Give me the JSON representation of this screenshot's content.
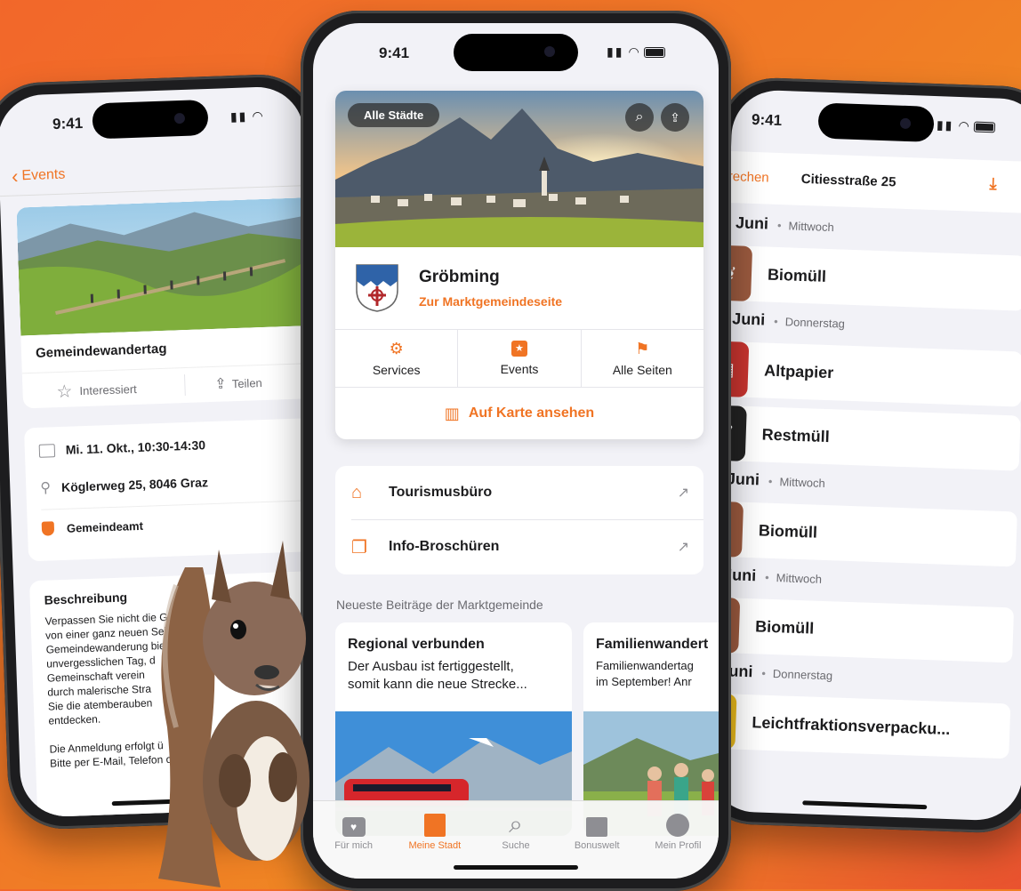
{
  "left_phone": {
    "status_time": "9:41",
    "nav_back_label": "Events",
    "event_title": "Gemeindewandertag",
    "action_interested": "Interessiert",
    "action_share": "Teilen",
    "detail_date": "Mi. 11. Okt., 10:30-14:30",
    "detail_address": "Köglerweg 25, 8046 Graz",
    "detail_organizer": "Gemeindeamt",
    "description_heading": "Beschreibung",
    "description_lines": [
      "Verpassen Sie nicht die Gel",
      "von einer ganz neuen Seite",
      "Gemeindewanderung bie",
      "unvergesslichen Tag, d",
      "Gemeinschaft verein",
      "durch malerische Stra",
      "Sie die atemberauben",
      "entdecken."
    ],
    "registration_lines": [
      "Die Anmeldung erfolgt ü",
      "Bitte per E-Mail, Telefon od"
    ]
  },
  "center_phone": {
    "status_time": "9:41",
    "all_cities_chip": "Alle Städte",
    "town_name": "Gröbming",
    "town_link": "Zur Marktgemeindeseite",
    "quick_actions": [
      {
        "label": "Services",
        "icon": "hand-gear-icon"
      },
      {
        "label": "Events",
        "icon": "calendar-star-icon"
      },
      {
        "label": "Alle Seiten",
        "icon": "flag-icon"
      }
    ],
    "map_link": "Auf Karte ansehen",
    "links": [
      {
        "label": "Tourismusbüro",
        "icon": "store-icon"
      },
      {
        "label": "Info-Broschüren",
        "icon": "documents-icon"
      }
    ],
    "news_section_label": "Neueste Beiträge der Marktgemeinde",
    "news": [
      {
        "title": "Regional verbunden",
        "text_line1": "Der Ausbau ist fertiggestellt,",
        "text_line2": "somit kann die neue Strecke..."
      },
      {
        "title": "Familienwandert",
        "text_line1": "Familienwandertag",
        "text_line2": "im September! Anr"
      }
    ],
    "tabs": [
      {
        "label": "Für mich",
        "icon": "heart-box-icon",
        "active": false
      },
      {
        "label": "Meine Stadt",
        "icon": "buildings-icon",
        "active": true
      },
      {
        "label": "Suche",
        "icon": "search-icon",
        "active": false
      },
      {
        "label": "Bonuswelt",
        "icon": "gift-icon",
        "active": false
      },
      {
        "label": "Mein Profil",
        "icon": "profile-icon",
        "active": false
      }
    ]
  },
  "right_phone": {
    "status_time": "9:41",
    "header_left": "rechen",
    "header_title": "Citiesstraße 25",
    "groups": [
      {
        "date": "Juni",
        "weekday": "Mittwoch",
        "items": [
          {
            "label": "Biomüll",
            "color": "#9b5a3f",
            "icon": "leaf-icon"
          }
        ]
      },
      {
        "date": "Juni",
        "weekday": "Donnerstag",
        "items": [
          {
            "label": "Altpapier",
            "color": "#c8342f",
            "icon": "paper-icon"
          },
          {
            "label": "Restmüll",
            "color": "#222222",
            "icon": "trash-icon"
          }
        ]
      },
      {
        "date": "Juni",
        "weekday": "Mittwoch",
        "items": [
          {
            "label": "Biomüll",
            "color": "#9b5a3f",
            "icon": "leaf-icon"
          }
        ]
      },
      {
        "date": "Juni",
        "weekday": "Mittwoch",
        "items": [
          {
            "label": "Biomüll",
            "color": "#9b5a3f",
            "icon": "leaf-icon"
          }
        ]
      },
      {
        "date": "Juni",
        "weekday": "Donnerstag",
        "items": [
          {
            "label": "Leichtfraktionsverpacku...",
            "color": "#e8b91c",
            "icon": "bottle-icon"
          }
        ]
      }
    ]
  },
  "colors": {
    "accent": "#f07424",
    "background_orange": "#f07a26"
  }
}
